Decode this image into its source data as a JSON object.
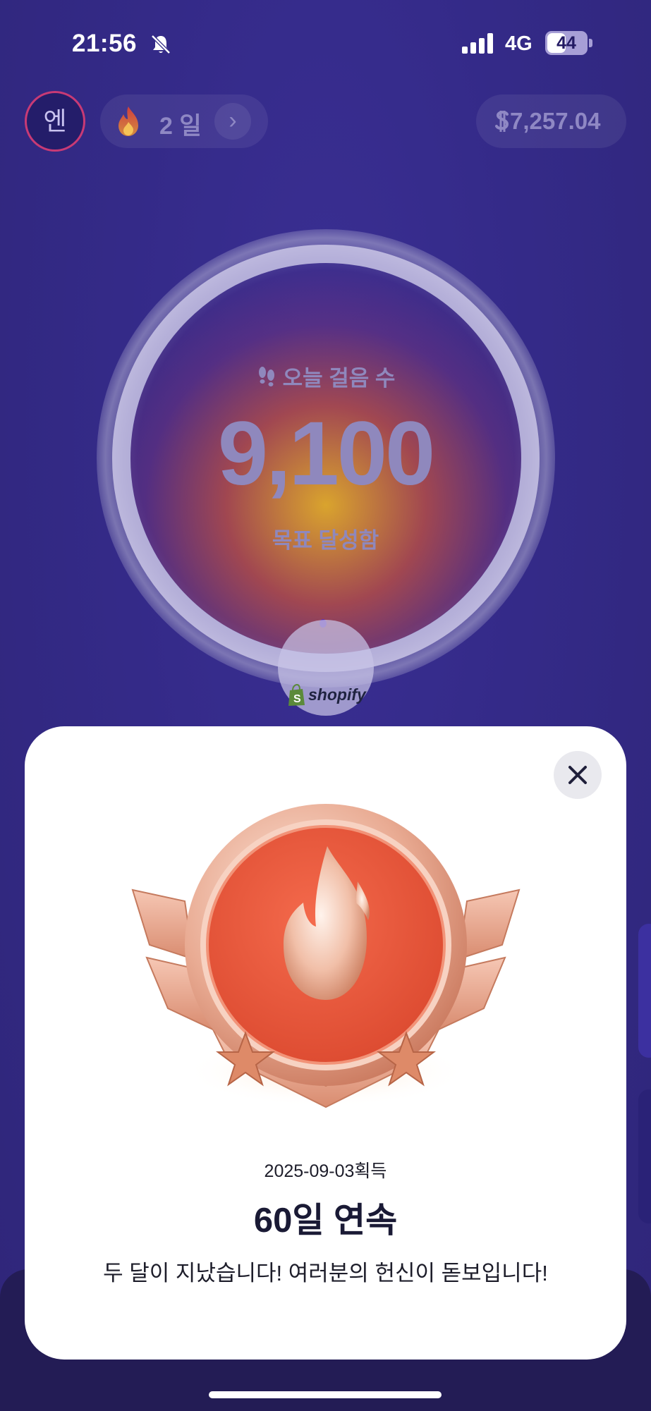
{
  "status_bar": {
    "time": "21:56",
    "network": "4G",
    "battery": "44"
  },
  "header": {
    "avatar_initial": "엔",
    "streak_label": "2 일",
    "coins": "7,257.04"
  },
  "steps_ring": {
    "caption": "오늘 걸음 수",
    "step_count": "9,100",
    "goal_status": "목표 달성함",
    "goal_progress": 1.0
  },
  "sponsor": {
    "name": "shopify"
  },
  "achievement_modal": {
    "earned_date": "2025-09-03획득",
    "title": "60일 연속",
    "description": "두 달이 지났습니다! 여러분의 헌신이 돋보입니다!"
  },
  "colors": {
    "background": "#332a86",
    "modal": "#ffffff",
    "badge_red": "#e65438",
    "badge_rose_gold": "#e7a88f"
  },
  "icons": [
    "bell-muted-icon",
    "signal-icon",
    "battery-icon",
    "fire-icon",
    "chevron-right-icon",
    "coin-icon",
    "footprints-icon",
    "shopify-bag-icon",
    "close-icon",
    "flame-badge-icon",
    "star-icon"
  ]
}
